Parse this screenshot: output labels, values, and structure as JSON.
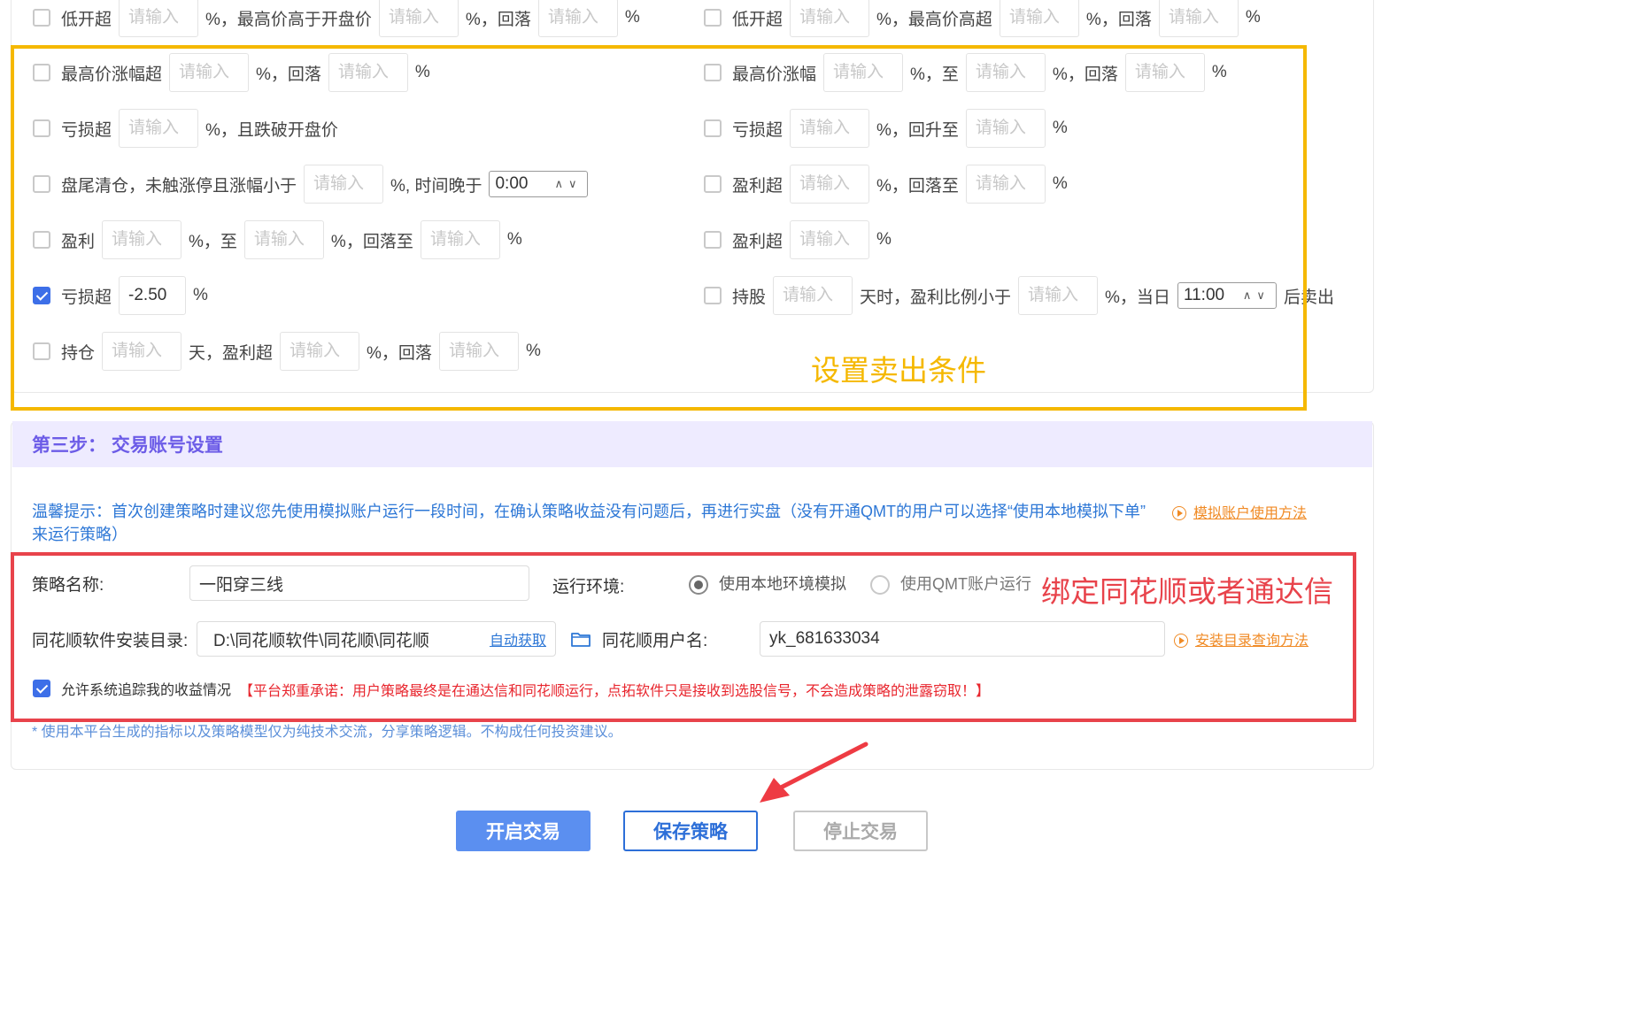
{
  "placeholder": "请输入",
  "percent": "%",
  "colors": {
    "accent": "#3d6fe8",
    "highlight_yellow": "#f5b800",
    "highlight_red": "#e8434b",
    "tip_blue": "#2d77d6",
    "link_orange": "#f08a24",
    "step_purple": "#6c5ce7"
  },
  "conditions": {
    "left": [
      {
        "checked": false,
        "parts": [
          "低开超",
          "input",
          "%，最高价高于开盘价",
          "input",
          "%，回落",
          "input",
          "%"
        ]
      },
      {
        "checked": false,
        "parts": [
          "最高价涨幅超",
          "input",
          "%，回落",
          "input",
          "%"
        ]
      },
      {
        "checked": false,
        "parts": [
          "亏损超",
          "input",
          "%，且跌破开盘价"
        ]
      },
      {
        "checked": false,
        "parts": [
          "盘尾清仓，未触涨停且涨幅小于",
          "input",
          "%, 时间晚于",
          "time:0:00"
        ]
      },
      {
        "checked": false,
        "parts": [
          "盈利",
          "input",
          "%，至",
          "input",
          "%，回落至",
          "input",
          "%"
        ]
      },
      {
        "checked": true,
        "parts": [
          "亏损超",
          "value:-2.50",
          "%"
        ]
      },
      {
        "checked": false,
        "parts": [
          "持仓",
          "input",
          "天，盈利超",
          "input",
          "%，回落",
          "input",
          "%"
        ]
      }
    ],
    "right": [
      {
        "checked": false,
        "parts": [
          "低开超",
          "input",
          "%，最高价高超",
          "input",
          "%，回落",
          "input",
          "%"
        ]
      },
      {
        "checked": false,
        "parts": [
          "最高价涨幅",
          "input",
          "%，至",
          "input",
          "%，回落",
          "input",
          "%"
        ]
      },
      {
        "checked": false,
        "parts": [
          "亏损超",
          "input",
          "%，回升至",
          "input",
          "%"
        ]
      },
      {
        "checked": false,
        "parts": [
          "盈利超",
          "input",
          "%，回落至",
          "input",
          "%"
        ]
      },
      {
        "checked": false,
        "parts": [
          "盈利超",
          "input",
          "%"
        ]
      },
      {
        "checked": false,
        "parts": [
          "持股",
          "input",
          "天时，盈利比例小于",
          "input",
          "%，当日",
          "time:11:00",
          "后卖出"
        ]
      }
    ]
  },
  "annotations": {
    "sell_conditions": "设置卖出条件",
    "bind_software": "绑定同花顺或者通达信"
  },
  "step3": {
    "title": "第三步：  交易账号设置",
    "tip_line1": "温馨提示：首次创建策略时建议您先使用模拟账户运行一段时间，在确认策略收益没有问题后，再进行实盘（没有开通QMT的用户可以选择“使用本地模拟下单”",
    "tip_line2": "来运行策略）",
    "sim_link": "模拟账户使用方法",
    "strategy_name_label": "策略名称:",
    "strategy_name_value": "一阳穿三线",
    "env_label": "运行环境:",
    "env_local": "使用本地环境模拟",
    "env_qmt": "使用QMT账户运行",
    "install_dir_label": "同花顺软件安装目录:",
    "install_dir_value": "D:\\同花顺软件\\同花顺\\同花顺",
    "auto_get": "自动获取",
    "username_label": "同花顺用户名:",
    "username_value": "yk_681633034",
    "install_help_link": "安装目录查询方法",
    "allow_tracking": "允许系统追踪我的收益情况",
    "promise": "【平台郑重承诺：用户策略最终是在通达信和同花顺运行，点拓软件只是接收到选股信号，不会造成策略的泄露窃取！】",
    "disclaimer": "* 使用本平台生成的指标以及策略模型仅为纯技术交流，分享策略逻辑。不构成任何投资建议。"
  },
  "buttons": {
    "start": "开启交易",
    "save": "保存策略",
    "stop": "停止交易"
  }
}
